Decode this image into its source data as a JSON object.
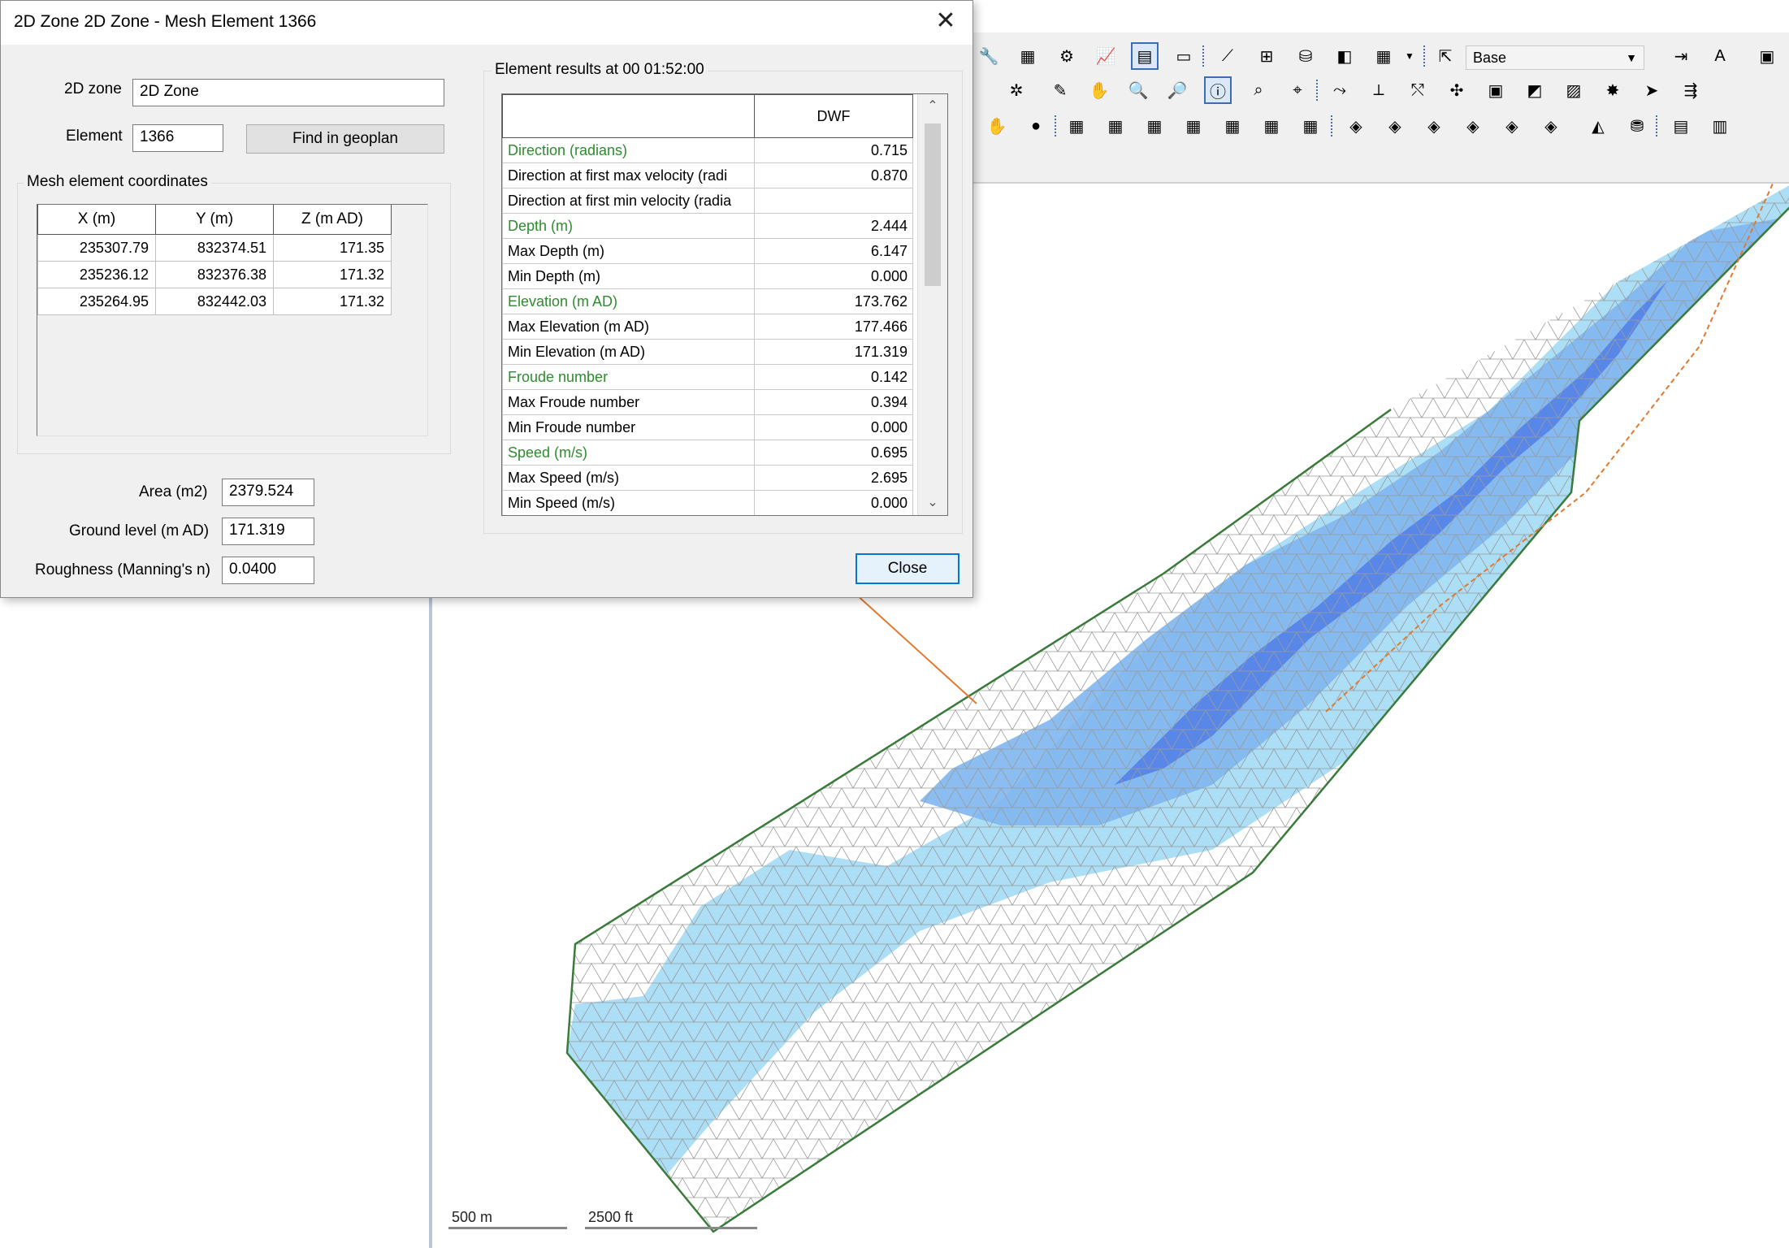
{
  "dialog": {
    "title": "2D Zone 2D Zone - Mesh Element 1366",
    "zone_label": "2D zone",
    "zone_value": "2D Zone",
    "element_label": "Element",
    "element_value": "1366",
    "find_button": "Find in geoplan",
    "coords_group": "Mesh element coordinates",
    "coords_headers": [
      "X (m)",
      "Y (m)",
      "Z (m AD)"
    ],
    "coords_rows": [
      [
        "235307.79",
        "832374.51",
        "171.35"
      ],
      [
        "235236.12",
        "832376.38",
        "171.32"
      ],
      [
        "235264.95",
        "832442.03",
        "171.32"
      ]
    ],
    "area_label": "Area (m2)",
    "area_value": "2379.524",
    "ground_label": "Ground level (m AD)",
    "ground_value": "171.319",
    "roughness_label": "Roughness (Manning's n)",
    "roughness_value": "0.0400",
    "results_group": "Element results at 00 01:52:00",
    "results_column": "DWF",
    "results_rows": [
      {
        "name": "Direction (radians)",
        "value": "0.715",
        "highlight": true
      },
      {
        "name": "Direction at first max velocity (radi",
        "value": "0.870",
        "highlight": false
      },
      {
        "name": "Direction at first min velocity (radia",
        "value": "",
        "highlight": false
      },
      {
        "name": "Depth (m)",
        "value": "2.444",
        "highlight": true
      },
      {
        "name": "Max Depth (m)",
        "value": "6.147",
        "highlight": false
      },
      {
        "name": "Min Depth (m)",
        "value": "0.000",
        "highlight": false
      },
      {
        "name": "Elevation (m AD)",
        "value": "173.762",
        "highlight": true
      },
      {
        "name": "Max Elevation (m AD)",
        "value": "177.466",
        "highlight": false
      },
      {
        "name": "Min Elevation (m AD)",
        "value": "171.319",
        "highlight": false
      },
      {
        "name": "Froude number",
        "value": "0.142",
        "highlight": true
      },
      {
        "name": "Max Froude number",
        "value": "0.394",
        "highlight": false
      },
      {
        "name": "Min Froude number",
        "value": "0.000",
        "highlight": false
      },
      {
        "name": "Speed (m/s)",
        "value": "0.695",
        "highlight": true
      },
      {
        "name": "Max Speed (m/s)",
        "value": "2.695",
        "highlight": false
      },
      {
        "name": "Min Speed (m/s)",
        "value": "0.000",
        "highlight": false
      }
    ],
    "close_button": "Close"
  },
  "toolbar": {
    "scenario": "Base"
  },
  "map": {
    "scale_metric": "500 m",
    "scale_imperial": "2500 ft"
  },
  "colors": {
    "highlight_text": "#2e8b2e",
    "mesh_light": "#a8dcf5",
    "mesh_mid": "#7fb6ee",
    "mesh_deep": "#4d7ae6",
    "boundary": "#3a7a3a"
  }
}
